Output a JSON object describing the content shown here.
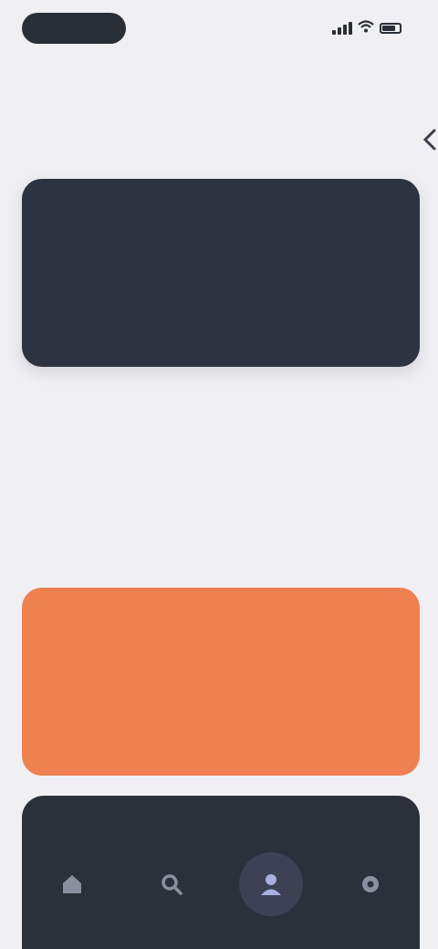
{
  "status_bar": {
    "time": "",
    "icons": [
      "signal-icon",
      "wifi-icon",
      "battery-icon"
    ]
  },
  "header": {
    "title": "",
    "back_icon": "chevron-icon"
  },
  "hero_card": {
    "label": "",
    "text": ""
  },
  "section": {
    "label": ""
  },
  "info": {
    "text": ""
  },
  "accent_card": {
    "label": "",
    "text": "",
    "color": "#ef8050"
  },
  "bottom_nav": {
    "items": [
      {
        "icon": "home-icon",
        "active": false
      },
      {
        "icon": "search-icon",
        "active": false
      },
      {
        "icon": "profile-icon",
        "active": true
      },
      {
        "icon": "settings-icon",
        "active": false
      }
    ]
  },
  "colors": {
    "background": "#f0f0f4",
    "dark_card": "#2d3340",
    "accent": "#ef8050",
    "nav": "#2b303b"
  }
}
